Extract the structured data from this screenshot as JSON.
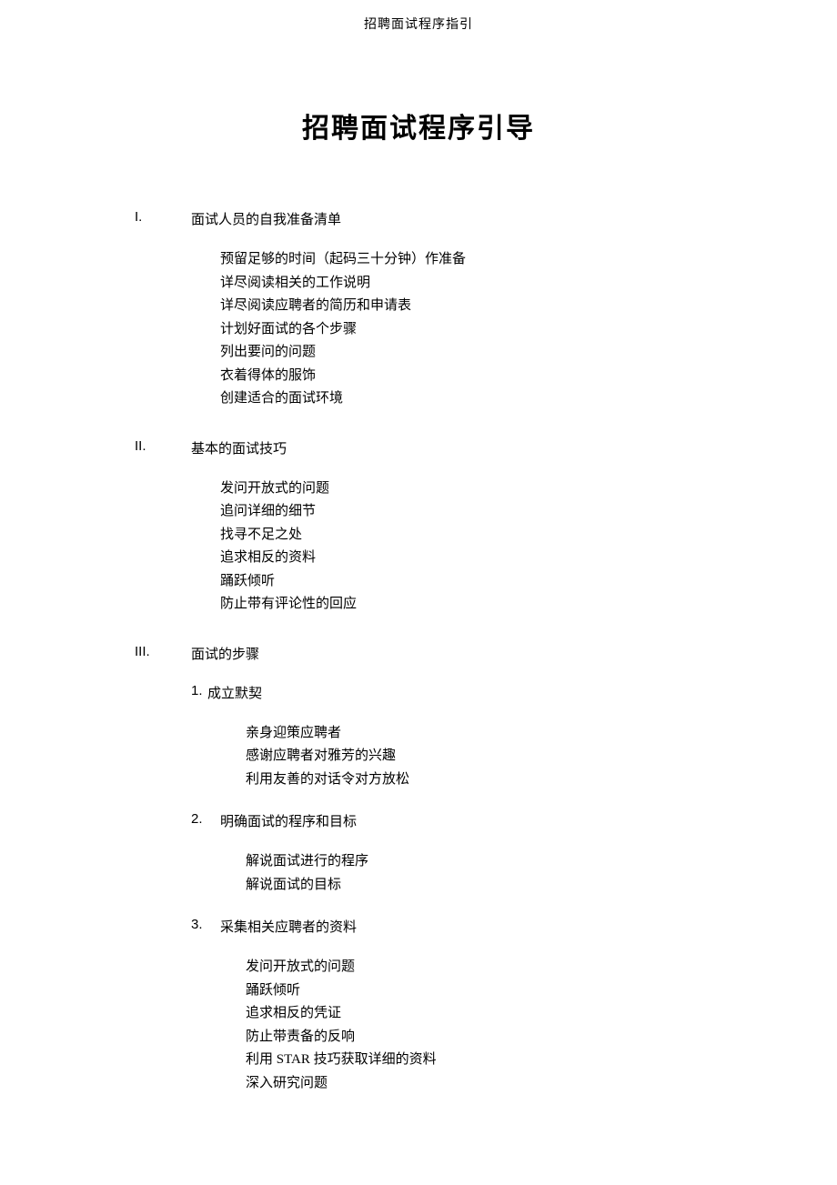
{
  "header": "招聘面试程序指引",
  "title": "招聘面试程序引导",
  "sections": [
    {
      "num": "I.",
      "title": "面试人员的自我准备清单",
      "items": [
        "预留足够的时间（起码三十分钟）作准备",
        "详尽阅读相关的工作说明",
        "详尽阅读应聘者的简历和申请表",
        "计划好面试的各个步骤",
        "列出要问的问题",
        "衣着得体的服饰",
        "创建适合的面试环境"
      ]
    },
    {
      "num": "II.",
      "title": "基本的面试技巧",
      "items": [
        "发问开放式的问题",
        "追问详细的细节",
        "找寻不足之处",
        "追求相反的资料",
        "踊跃倾听",
        "防止带有评论性的回应"
      ]
    },
    {
      "num": "III.",
      "title": "面试的步骤",
      "subsections": [
        {
          "num": "1.",
          "title": "成立默契",
          "tight": true,
          "items": [
            "亲身迎策应聘者",
            "感谢应聘者对雅芳的兴趣",
            "利用友善的对话令对方放松"
          ]
        },
        {
          "num": "2.",
          "title": "明确面试的程序和目标",
          "items": [
            "解说面试进行的程序",
            "解说面试的目标"
          ]
        },
        {
          "num": "3.",
          "title": "采集相关应聘者的资料",
          "items": [
            "发问开放式的问题",
            "踊跃倾听",
            "追求相反的凭证",
            "防止带责备的反响",
            "利用 STAR 技巧获取详细的资料",
            "深入研究问题"
          ]
        }
      ]
    }
  ]
}
